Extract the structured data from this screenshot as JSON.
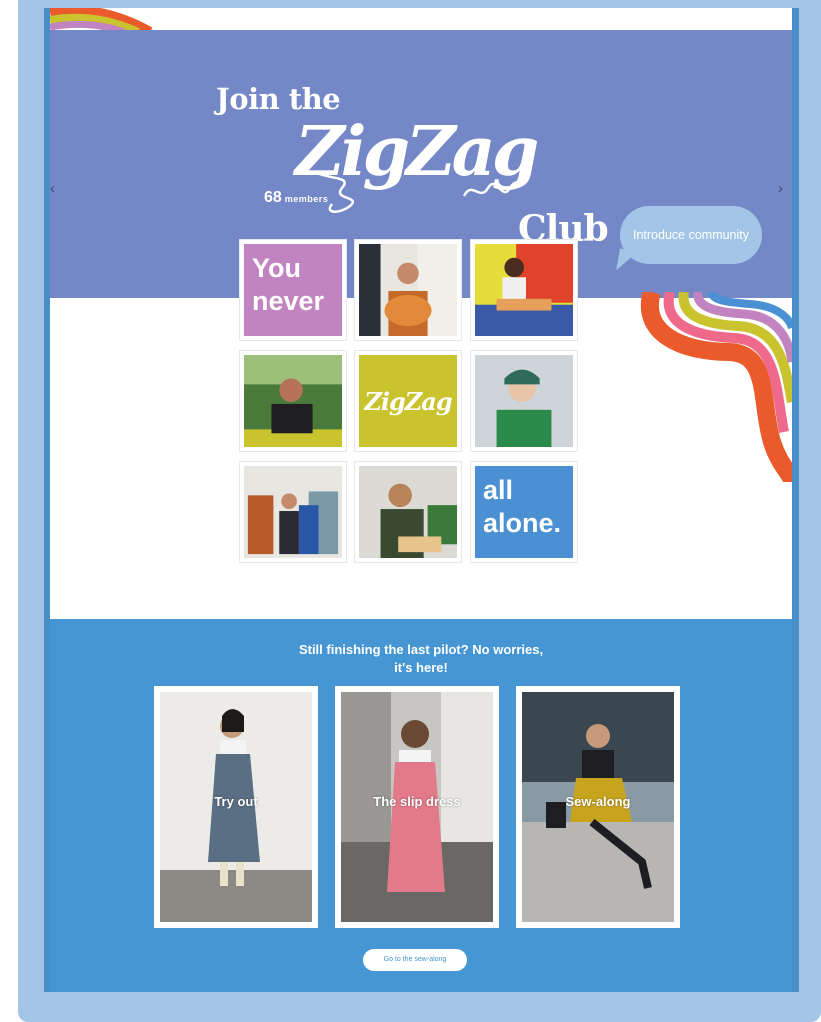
{
  "hero": {
    "title_line1": "Join the",
    "title_word": "ZigZag",
    "title_line3": "Club",
    "member_count": "68",
    "member_label": "members",
    "prev_arrow": "‹",
    "next_arrow": "›",
    "introduce_button": "Introduce community"
  },
  "grid": {
    "text_tile_1": "You never",
    "logo_tile": "ZigZag",
    "text_tile_2": "all alone.",
    "colors": {
      "purple": "#c184c0",
      "lime": "#c9c42e",
      "blue": "#4a90d2"
    }
  },
  "pilot_section": {
    "heading": "Still finishing the last pilot? No worries, it's here!",
    "cards": [
      {
        "caption": "Try out"
      },
      {
        "caption": "The slip dress"
      },
      {
        "caption": "Sew-along"
      }
    ],
    "cta": "Go to the sew-along"
  },
  "colors": {
    "hero_bg": "#7487c6",
    "section_bg": "#4596d3",
    "frame": "#a3c6e8"
  }
}
